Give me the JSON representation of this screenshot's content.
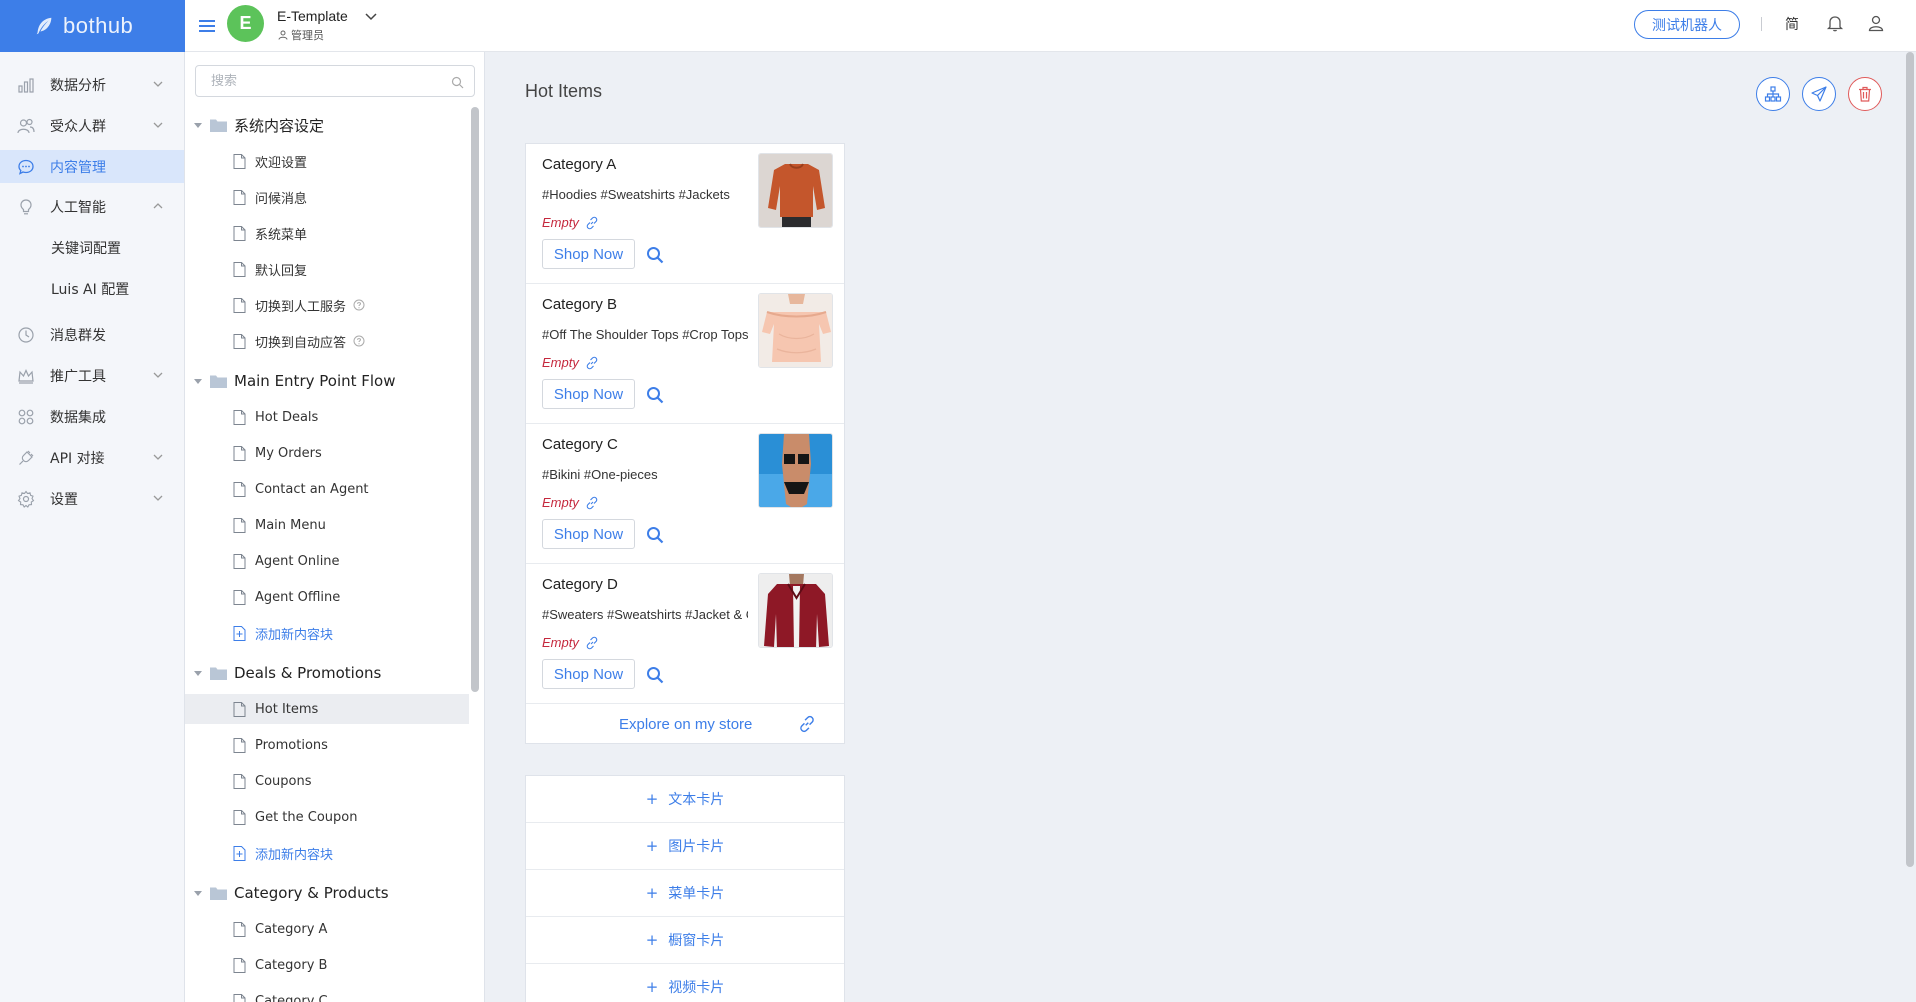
{
  "brand": {
    "logo_text": "bothub",
    "accent": "#3d7ee8"
  },
  "workspace": {
    "avatar_letter": "E",
    "name": "E-Template",
    "role": "管理员"
  },
  "topbar": {
    "test_bot_label": "测试机器人",
    "lang_label": "简"
  },
  "nav": {
    "items": [
      {
        "label": "数据分析",
        "icon": "bar-chart-icon"
      },
      {
        "label": "受众人群",
        "icon": "users-icon"
      },
      {
        "label": "内容管理",
        "icon": "chat-bubble-icon"
      },
      {
        "label": "人工智能",
        "icon": "bulb-icon"
      },
      {
        "label": "消息群发",
        "icon": "clock-icon"
      },
      {
        "label": "推广工具",
        "icon": "crown-icon"
      },
      {
        "label": "数据集成",
        "icon": "grid-icon"
      },
      {
        "label": "API 对接",
        "icon": "plug-icon"
      },
      {
        "label": "设置",
        "icon": "gear-icon"
      }
    ],
    "ai_sub": [
      "关键词配置",
      "Luis AI 配置"
    ]
  },
  "tree": {
    "search_placeholder": "搜索",
    "folders": [
      {
        "label": "系统内容设定",
        "items": [
          "欢迎设置",
          "问候消息",
          "系统菜单",
          "默认回复",
          "切换到人工服务",
          "切换到自动应答"
        ]
      },
      {
        "label": "Main Entry Point Flow",
        "items": [
          "Hot Deals",
          "My Orders",
          "Contact an Agent",
          "Main Menu",
          "Agent Online",
          "Agent Offline"
        ],
        "add_label": "添加新内容块"
      },
      {
        "label": "Deals & Promotions",
        "items": [
          "Hot Items",
          "Promotions",
          "Coupons",
          "Get the Coupon"
        ],
        "add_label": "添加新内容块"
      },
      {
        "label": "Category & Products",
        "items": [
          "Category A",
          "Category B",
          "Category C"
        ]
      }
    ]
  },
  "main": {
    "title": "Hot Items",
    "gallery": [
      {
        "title": "Category A",
        "tags": "#Hoodies #Sweatshirts #Jackets",
        "empty_label": "Empty",
        "button_label": "Shop Now"
      },
      {
        "title": "Category B",
        "tags": "#Off The Shoulder Tops #Crop Tops",
        "empty_label": "Empty",
        "button_label": "Shop Now"
      },
      {
        "title": "Category C",
        "tags": "#Bikini #One-pieces",
        "empty_label": "Empty",
        "button_label": "Shop Now"
      },
      {
        "title": "Category D",
        "tags": "#Sweaters #Sweatshirts #Jacket & Coats",
        "empty_label": "Empty",
        "button_label": "Shop Now"
      }
    ],
    "footer_link": "Explore on my store",
    "add_cards": [
      "文本卡片",
      "图片卡片",
      "菜单卡片",
      "橱窗卡片",
      "视频卡片"
    ]
  }
}
